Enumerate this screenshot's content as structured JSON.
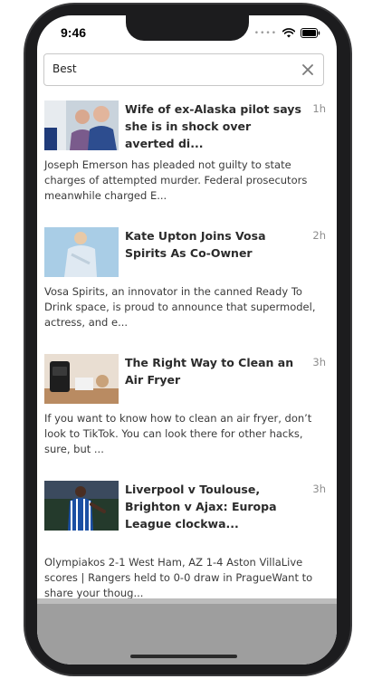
{
  "status_bar": {
    "time": "9:46"
  },
  "search": {
    "query": "Best"
  },
  "articles": [
    {
      "title": "Wife of ex-Alaska pilot says she is in shock over averted di...",
      "time_ago": "1h",
      "summary": "Joseph Emerson has pleaded not guilty to state charges of attempted murder. Federal prosecutors meanwhile charged E..."
    },
    {
      "title": "Kate Upton Joins Vosa Spirits As Co-Owner",
      "time_ago": "2h",
      "summary": "Vosa Spirits, an innovator in the canned Ready To Drink space, is proud to announce that supermodel, actress, and e..."
    },
    {
      "title": "The Right Way to Clean an Air Fryer",
      "time_ago": "3h",
      "summary": "If you want to know how to clean an air fryer, don’t look to TikTok. You can look there for other hacks, sure, but ..."
    },
    {
      "title": "Liverpool v Toulouse, Brighton v Ajax: Europa League clockwa...",
      "time_ago": "3h",
      "summary": "Olympiakos 2-1 West Ham, AZ 1-4 Aston VillaLive scores | Rangers held to 0-0 draw in PragueWant to share your thoug..."
    }
  ],
  "icons": {
    "clear": "close-icon",
    "wifi": "wifi-icon",
    "battery": "battery-icon",
    "signal": "signal-dots-icon"
  },
  "colors": {
    "accent_blue": "#1b4fa3",
    "text_dark": "#2b2b2b",
    "muted": "#8e8e8e"
  }
}
